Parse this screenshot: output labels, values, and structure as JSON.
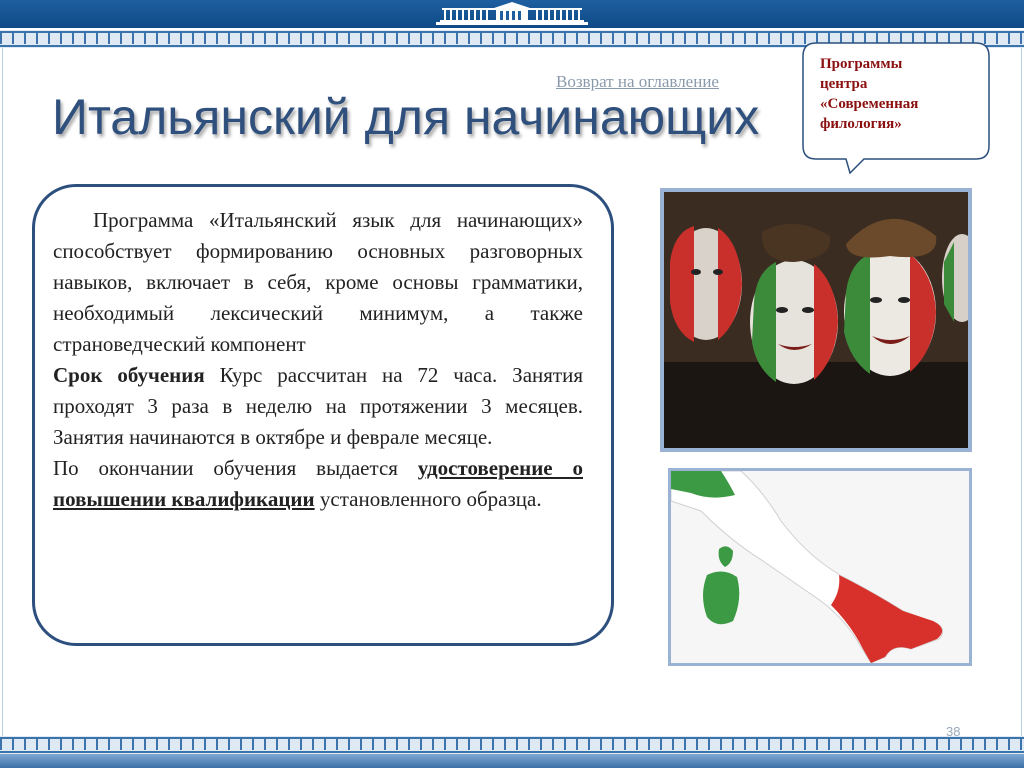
{
  "navigation": {
    "back_link": "Возврат на  оглавление"
  },
  "title": "Итальянский для начинающих",
  "callout": {
    "lines": [
      "Программы",
      "центра",
      "«Современная",
      "филология»"
    ]
  },
  "content": {
    "para1": "Программа «Итальянский язык для начинающих» способствует формированию основных разговорных навыков, включает в себя, кроме основы грамматики, необходимый лексический минимум, а также страноведческий компонент",
    "para2_bold": "Срок обучения",
    "para2_text": " Курс рассчитан на 72 часа. Занятия проходят 3 раза в неделю на протяжении 3 месяцев. Занятия начинаются в октябре и феврале месяце.",
    "para3_text1": "По окончании обучения выдается ",
    "para3_bold": "удостоверение о повышении квалификации",
    "para3_text2": " установленного образца."
  },
  "images": {
    "photo_icon": "fans-with-italian-flag-face-paint",
    "map_icon": "italy-map-flag-colors"
  },
  "colors": {
    "title": "#2f4f7c",
    "callout_text": "#8b1010",
    "box_border": "#2c4f7d",
    "band": "#1f5fa0"
  },
  "page_number": "38"
}
